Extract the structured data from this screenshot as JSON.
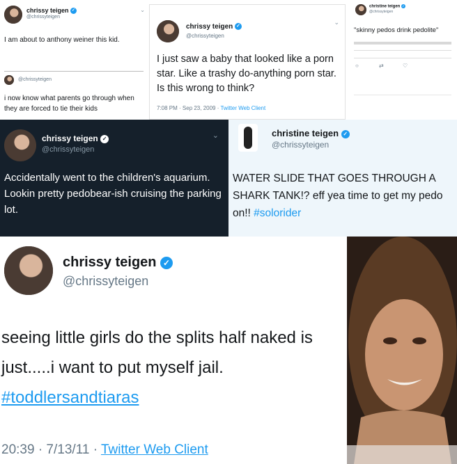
{
  "colors": {
    "link": "#1d9bf0",
    "dark_bg": "#15202b",
    "light_bg": "#eef6fb",
    "verified": "#1d9bf0"
  },
  "icons": [
    "verified-icon",
    "chevron-down-icon",
    "reply-icon",
    "retweet-icon",
    "like-icon"
  ],
  "panel1": {
    "name": "chrissy teigen",
    "handle": "@chrissyteigen",
    "tweet": "I am about to anthony weiner this kid.",
    "handle2": "@chrissyteigen",
    "tweet2": "i now know what parents go through when they are forced to tie their kids"
  },
  "panel2": {
    "name": "chrissy teigen",
    "handle": "@chrissyteigen",
    "tweet": "I just saw a baby that looked like a porn star. Like a trashy do-anything porn star. Is this wrong to think?",
    "time": "7:08 PM · Sep 23, 2009 · ",
    "client": "Twitter Web Client"
  },
  "panel3": {
    "name": "christine teigen",
    "handle": "@chrissyteigen",
    "tweet": "\"skinny pedos drink pedolite\""
  },
  "panel4": {
    "name": "chrissy teigen",
    "handle": "@chrissyteigen",
    "tweet": "Accidentally went to the children's aquarium. Lookin pretty pedobear-ish cruising the parking lot."
  },
  "panel5": {
    "name": "christine teigen",
    "handle": "@chrissyteigen",
    "tweet_text": "WATER SLIDE THAT GOES THROUGH A SHARK TANK!? eff yea time to get my pedo on!! ",
    "hashtag": "#solorider"
  },
  "panel6": {
    "name": "chrissy teigen",
    "handle": "@chrissyteigen",
    "tweet_text": "seeing little girls do the splits half naked is just.....i want to put myself jail. ",
    "hashtag": "#toddlersandtiaras",
    "time": "20:39 · 7/13/11 · ",
    "client": "Twitter Web Client"
  }
}
